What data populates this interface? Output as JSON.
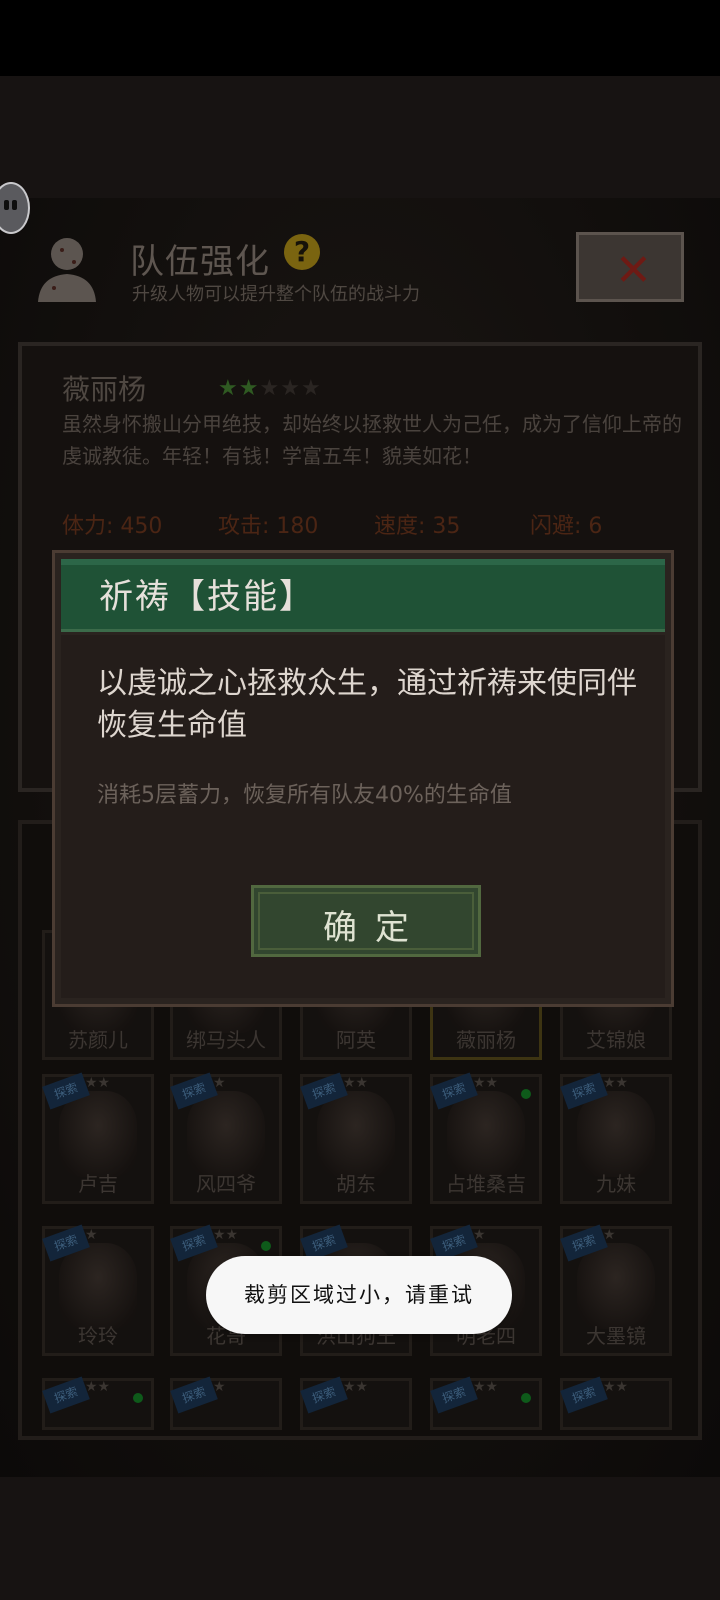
{
  "header": {
    "title": "队伍强化",
    "help_symbol": "?",
    "subtitle": "升级人物可以提升整个队伍的战斗力",
    "close_symbol": "✕"
  },
  "character": {
    "name": "薇丽杨",
    "stars_filled": 2,
    "stars_total": 5,
    "description": "虽然身怀搬山分甲绝技，却始终以拯救世人为己任，成为了信仰上帝的虔诚教徒。年轻！有钱！学富五车！貌美如花！",
    "stats": [
      {
        "label": "体力: 450"
      },
      {
        "label": "攻击: 180"
      },
      {
        "label": "速度: 35"
      },
      {
        "label": "闪避: 6"
      }
    ]
  },
  "roster": {
    "tag_label": "探索",
    "star_symbol": "★",
    "top_row": [
      "苏颜儿",
      "绑马头人",
      "阿英",
      "薇丽杨",
      "艾锦娘"
    ],
    "row2": [
      "卢吉",
      "风四爷",
      "胡东",
      "占堆桑吉",
      "九妹"
    ],
    "row3": [
      "玲玲",
      "花哥",
      "洪山狗王",
      "明老四",
      "大墨镜"
    ]
  },
  "dialog": {
    "title": "祈祷【技能】",
    "skill_text": "以虔诚之心拯救众生，通过祈祷来使同伴恢复生命值",
    "cost_text": "消耗5层蓄力，恢复所有队友40%的生命值",
    "ok_label": "确定"
  },
  "toast": {
    "message": "裁剪区域过小，请重试"
  },
  "colors": {
    "dialog_header": "#1f5236",
    "dialog_body": "#241d1a",
    "ok_button": "#32462f",
    "star_on": "#2f5a22"
  }
}
